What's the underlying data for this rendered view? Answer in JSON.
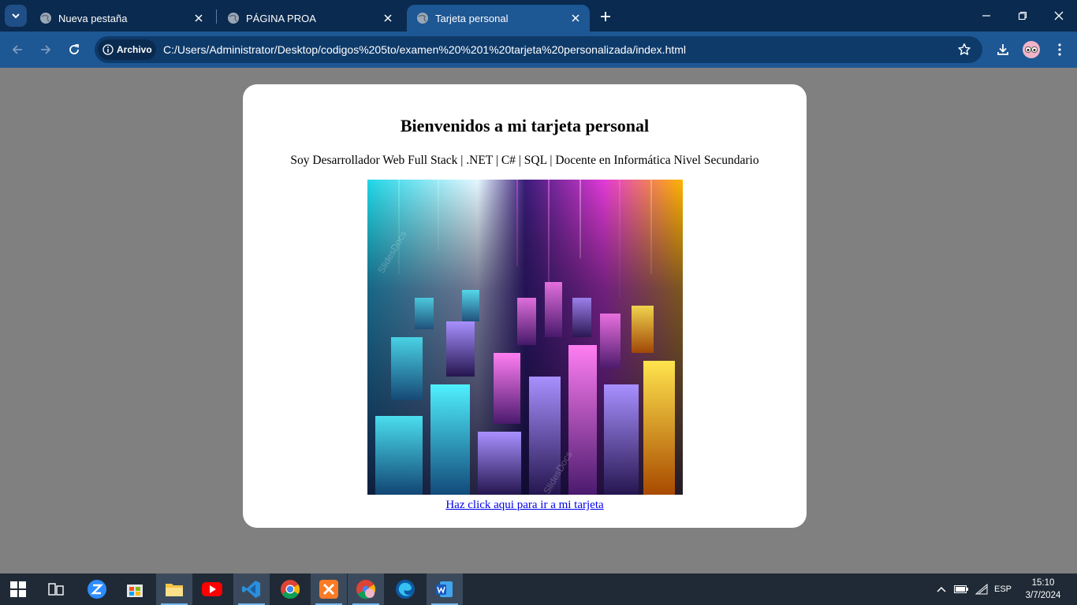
{
  "browser": {
    "tabs": [
      {
        "title": "Nueva pestaña"
      },
      {
        "title": "PÁGINA PROA"
      },
      {
        "title": "Tarjeta personal",
        "active": true
      }
    ],
    "site_chip": "Archivo",
    "url": "C:/Users/Administrator/Desktop/codigos%205to/examen%20%201%20tarjeta%20personalizada/index.html",
    "icons": [
      "tab-search-icon",
      "globe-icon",
      "close-icon",
      "plus-icon",
      "minimize-icon",
      "restore-icon",
      "window-close-icon",
      "back-arrow-icon",
      "forward-arrow-icon",
      "reload-icon",
      "info-icon",
      "star-icon",
      "download-icon",
      "profile-avatar",
      "kebab-menu-icon"
    ],
    "colors": {
      "frame": "#0a2a4f",
      "toolbar": "#1d5794",
      "omnibox": "#0e3a6a"
    }
  },
  "page": {
    "heading": "Bienvenidos a mi tarjeta personal",
    "subtitle": "Soy Desarrollador Web Full Stack | .NET | C# | SQL | Docente en Informática Nivel Secundario",
    "image": {
      "watermark": "SlidesDocs"
    },
    "link_text": "Haz click aqui para ir a mi tarjeta",
    "colors": {
      "background": "#808080",
      "card": "#ffffff",
      "link": "#0000ee"
    }
  },
  "taskbar": {
    "apps": [
      "windows-start",
      "task-view",
      "zoom",
      "microsoft-store",
      "file-explorer",
      "youtube",
      "visual-studio-code",
      "chrome",
      "xampp",
      "chrome-profile",
      "edge",
      "word"
    ],
    "language": "ESP",
    "time": "15:10",
    "date": "3/7/2024"
  }
}
